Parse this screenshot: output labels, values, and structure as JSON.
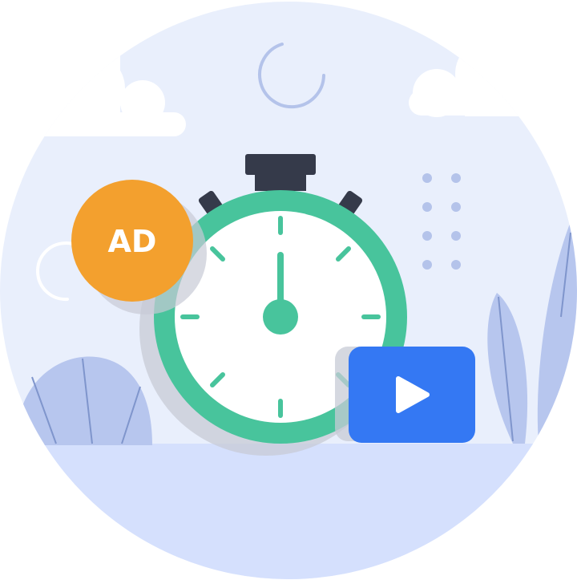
{
  "badge": {
    "label": "AD"
  },
  "colors": {
    "sky": "#E9EFFC",
    "ground": "#D5E0FD",
    "cloud": "#FFFFFF",
    "foliage": "#B7C6EE",
    "foliage_lines": "#7F95CC",
    "dots": "#B4C3EA",
    "stopwatch_ring": "#48C49C",
    "stopwatch_face": "#FFFFFF",
    "stopwatch_top": "#353A4A",
    "badge": "#F3A02E",
    "badge_text": "#FFFFFF",
    "play_button": "#3478F3",
    "play_icon": "#FFFFFF",
    "shadow": "#C7CBD6"
  },
  "icons": [
    "stopwatch-icon",
    "ad-badge",
    "play-button-icon",
    "loading-arc-icon"
  ]
}
